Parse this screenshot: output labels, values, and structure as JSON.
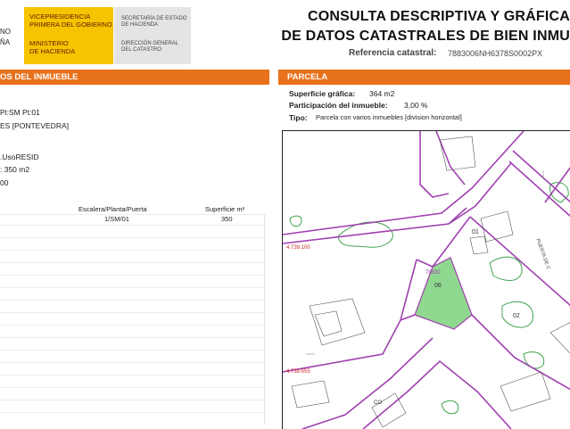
{
  "header": {
    "logo_left_lines": [
      "NO",
      "ÑA"
    ],
    "logo_yellow_top": [
      "VICEPRESIDENCIA",
      "PRIMERA DEL GOBIERNO"
    ],
    "logo_yellow_bottom": [
      "MINISTERIO",
      "DE HACIENDA"
    ],
    "logo_grey_top": [
      "SECRETARÍA DE ESTADO",
      "DE HACIENDA"
    ],
    "logo_grey_bottom": [
      "DIRECCIÓN GENERAL",
      "DEL CATASTRO"
    ],
    "title_line1": "CONSULTA DESCRIPTIVA Y GRÁFICA",
    "title_line2": "DE DATOS CATASTRALES DE BIEN INMU",
    "ref_label": "Referencia catastral:",
    "ref_value": "7883006NH6378S0002PX"
  },
  "left_panel": {
    "header": "OS DEL INMUEBLE",
    "lines": [
      "Pl:SM Pt:01",
      "ES [PONTEVEDRA]",
      ".UsoRESID",
      ": 350 m2",
      "00"
    ],
    "table": {
      "headers": [
        "Escalera/Planta/Puerta",
        "Superficie m²"
      ],
      "row": [
        "1/SM/01",
        "350"
      ]
    }
  },
  "right_panel": {
    "header": "PARCELA",
    "superficie_label": "Superficie gráfica:",
    "superficie_value": "364 m2",
    "participacion_label": "Participación del inmueble:",
    "participacion_value": "3,00 %",
    "tipo_label": "Tipo:",
    "tipo_value": "Parcela con varios inmuebles [division horizontal]"
  },
  "map": {
    "labels": [
      "01",
      "06",
      "02",
      "4.739.100",
      "4.738.655",
      "78830",
      "CO",
      "PUERTA DE C"
    ],
    "colors": {
      "parcel_line": "#a040b0",
      "vegetation": "#3fa34d",
      "highlight": "#8fd88f",
      "coord": "#d02a2a"
    }
  }
}
